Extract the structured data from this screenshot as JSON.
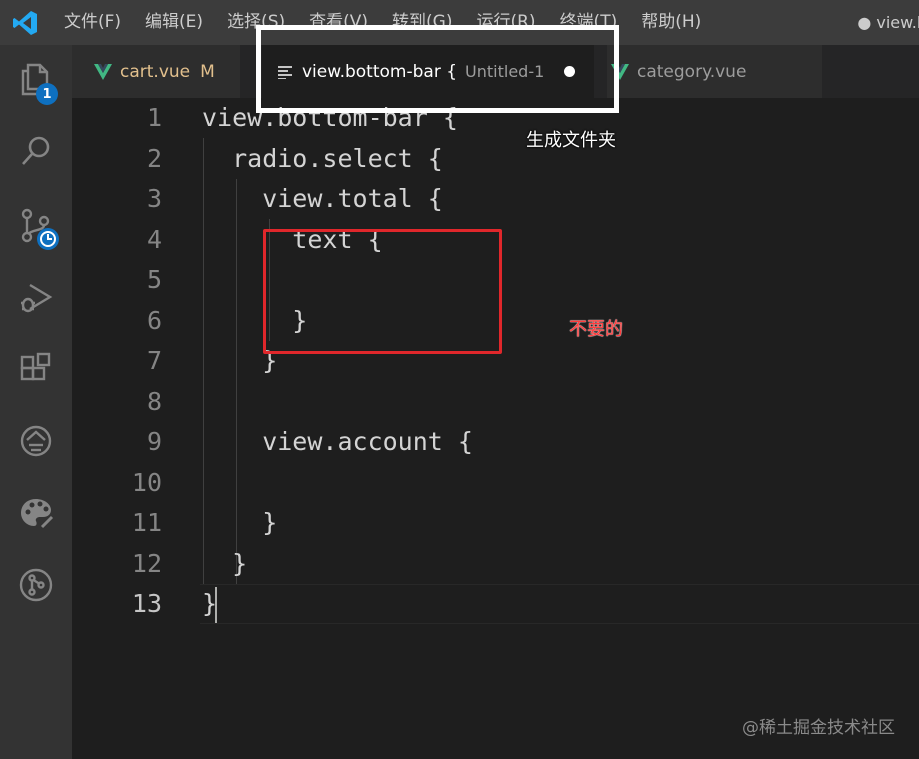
{
  "menu": {
    "items": [
      "文件(F)",
      "编辑(E)",
      "选择(S)",
      "查看(V)",
      "转到(G)",
      "运行(R)",
      "终端(T)",
      "帮助(H)"
    ],
    "title_right": "● view.b"
  },
  "activity": {
    "explorer_badge": "1",
    "icons": [
      "files-icon",
      "search-icon",
      "source-control-icon",
      "run-debug-icon",
      "extensions-icon",
      "remote-icon",
      "palette-icon",
      "git-graph-icon"
    ]
  },
  "tabs": [
    {
      "label": "cart.vue",
      "modified": "M"
    },
    {
      "label": "view.bottom-bar {",
      "description": "Untitled-1"
    },
    {
      "label": "category.vue"
    }
  ],
  "editor": {
    "lines": [
      {
        "num": "1",
        "code": "view.bottom-bar {"
      },
      {
        "num": "2",
        "code": "  radio.select {"
      },
      {
        "num": "3",
        "code": "    view.total {"
      },
      {
        "num": "4",
        "code": "      text {"
      },
      {
        "num": "5",
        "code": ""
      },
      {
        "num": "6",
        "code": "      }"
      },
      {
        "num": "7",
        "code": "    }"
      },
      {
        "num": "8",
        "code": ""
      },
      {
        "num": "9",
        "code": "    view.account {"
      },
      {
        "num": "10",
        "code": ""
      },
      {
        "num": "11",
        "code": "    }"
      },
      {
        "num": "12",
        "code": "  }"
      },
      {
        "num": "13",
        "code": "}"
      }
    ]
  },
  "annotations": {
    "generate_folder": "生成文件夹",
    "not_needed": "不要的"
  },
  "watermark": "@稀土掘金技术社区",
  "colors": {
    "accent_blue": "#0e70c0",
    "vue_green": "#41b883",
    "annotation_red": "#e0272b"
  }
}
